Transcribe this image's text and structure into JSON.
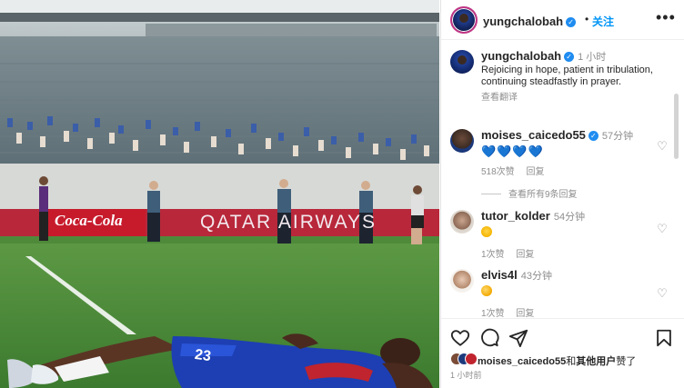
{
  "post": {
    "username": "yungchalobah",
    "verified_mark": "✓",
    "follow_label": "关注",
    "header_dot": "•",
    "more_icon": "more-horizontal-icon",
    "caption": {
      "username": "yungchalobah",
      "time": "1 小时",
      "text": "Rejoicing in hope, patient in tribulation, continuing steadfastly in prayer.",
      "translate_label": "查看翻译"
    },
    "photo": {
      "jersey_number": "23",
      "board_left": "Coca-Cola",
      "board_right": "QATAR AIRWAYS"
    }
  },
  "comments": [
    {
      "username": "moises_caicedo55",
      "verified": true,
      "time": "57分钟",
      "text": "💙💙💙💙",
      "likes_label": "518次赞",
      "reply_label": "回复"
    },
    {
      "username": "tutor_kolder",
      "verified": false,
      "time": "54分钟",
      "text": "🙌",
      "likes_label": "1次赞",
      "reply_label": "回复"
    },
    {
      "username": "elvis4l",
      "verified": false,
      "time": "43分钟",
      "text": "👏",
      "likes_label": "1次赞",
      "reply_label": "回复"
    }
  ],
  "view_replies_label": "查看所有9条回复",
  "actions": {
    "like_icon": "heart-icon",
    "comment_icon": "comment-icon",
    "share_icon": "send-icon",
    "save_icon": "bookmark-icon"
  },
  "liked_by": {
    "user": "moises_caicedo55",
    "and": "和",
    "others": "其他用户",
    "suffix": "赞了"
  },
  "post_time": "1 小时前",
  "colors": {
    "accent_blue": "#0095f6",
    "verified_blue": "#1f8cf0",
    "muted_text": "#8e8e8e"
  }
}
